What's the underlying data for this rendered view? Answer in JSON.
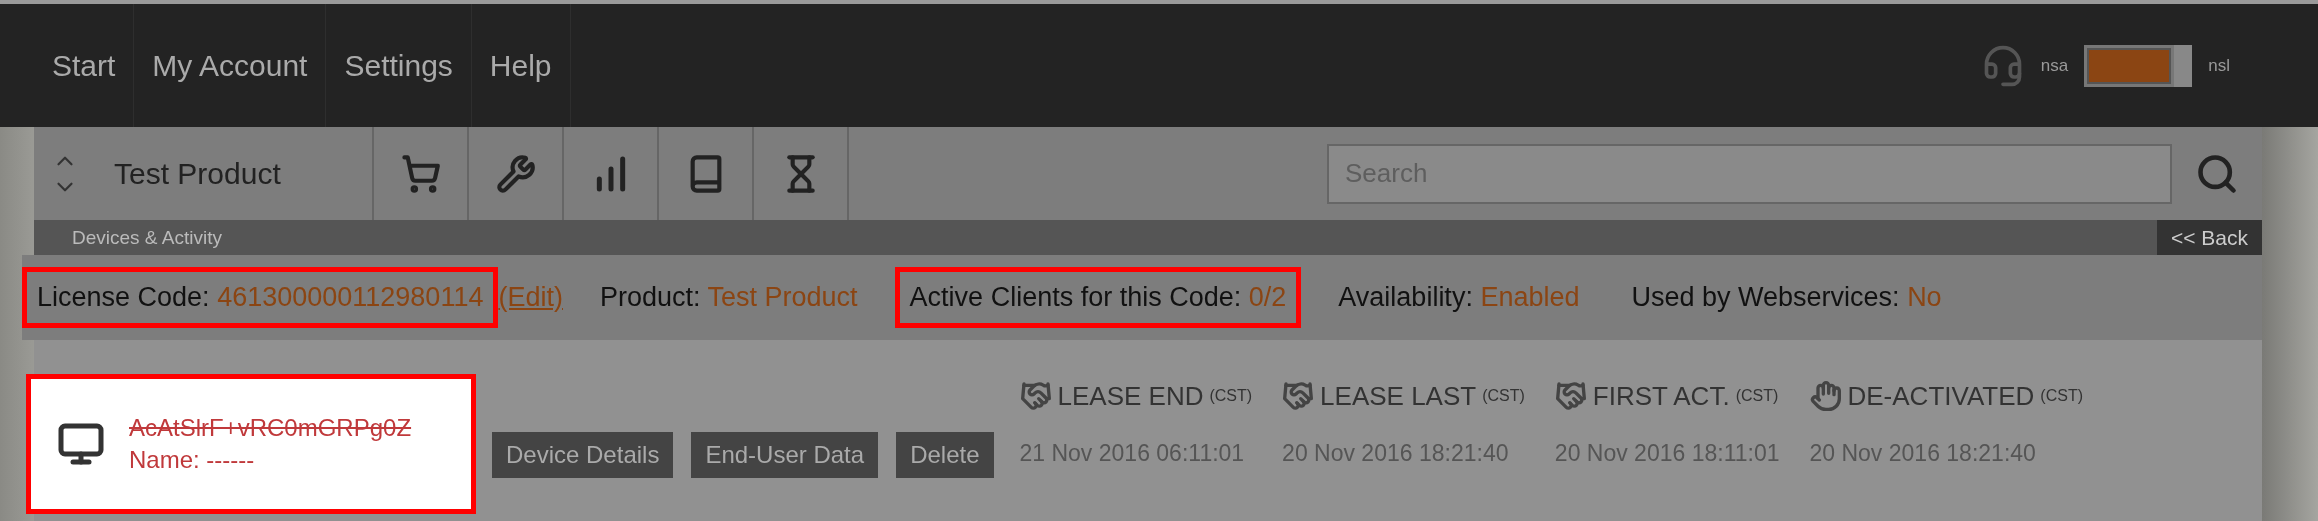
{
  "nav": [
    {
      "label": "Start"
    },
    {
      "label": "My Account"
    },
    {
      "label": "Settings"
    },
    {
      "label": "Help"
    }
  ],
  "switch": {
    "left_label": "nsa",
    "right_label": "nsl",
    "on": true
  },
  "product_selector": {
    "label": "Test Product"
  },
  "search": {
    "placeholder": "Search"
  },
  "section": {
    "title": "Devices & Activity",
    "back": "<< Back"
  },
  "info": [
    {
      "label": "License Code:",
      "value": "461300000112980114",
      "highlighted": true,
      "link": "(Edit)"
    },
    {
      "label": "Product:",
      "value": "Test Product",
      "highlighted": false
    },
    {
      "label": "Active Clients for this Code:",
      "value": "0/2",
      "highlighted": true
    },
    {
      "label": "Availability:",
      "value": "Enabled",
      "highlighted": false
    },
    {
      "label": "Used by Webservices:",
      "value": "No",
      "highlighted": false
    }
  ],
  "device": {
    "id": "AcAtSlrF+vRC0mGRPg0Z",
    "name": "Name: ------",
    "deactivated": true,
    "highlighted": true,
    "buttons": [
      "Device Details",
      "End-User Data",
      "Delete"
    ],
    "columns": [
      {
        "kind": "handshake",
        "title": "LEASE END",
        "zone": "(CST)",
        "date": "21 Nov 2016 06:11:01"
      },
      {
        "kind": "handshake",
        "title": "LEASE LAST",
        "zone": "(CST)",
        "date": "20 Nov 2016 18:21:40"
      },
      {
        "kind": "handshake",
        "title": "FIRST ACT.",
        "zone": "(CST)",
        "date": "20 Nov 2016 18:11:01"
      },
      {
        "kind": "wave",
        "title": "DE-ACTIVATED",
        "zone": "(CST)",
        "date": "20 Nov 2016 18:21:40"
      }
    ]
  }
}
